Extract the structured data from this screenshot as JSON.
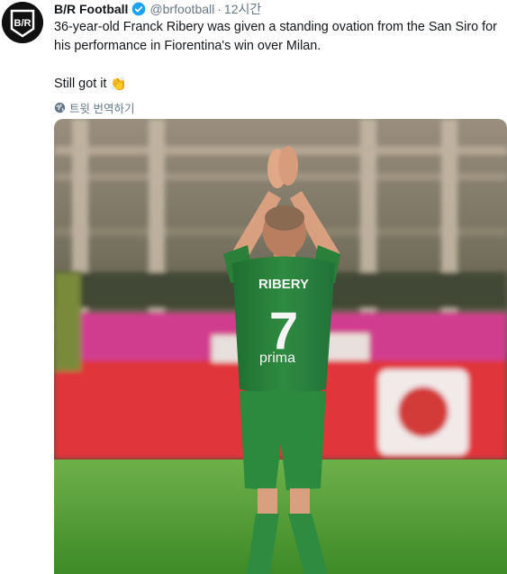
{
  "tweet": {
    "display_name": "B/R Football",
    "handle": "@brfootball",
    "separator": "·",
    "time": "12시간",
    "text_line1": "36-year-old Franck Ribery was given a standing ovation from the San Siro for his performance in Fiorentina's win over Milan.",
    "text_line2": "Still got it",
    "emoji": "👏",
    "translate_label": "트윗 번역하기",
    "avatar_text": "B/R"
  },
  "photo": {
    "jersey_name": "RIBERY",
    "jersey_number": "7",
    "sponsor": "prima",
    "colors": {
      "kit": "#2e8b40",
      "pitch": "#4ea235",
      "board": "#e0343b"
    }
  },
  "colors": {
    "text": "#14171a",
    "secondary": "#657786",
    "verified": "#1da1f2"
  }
}
